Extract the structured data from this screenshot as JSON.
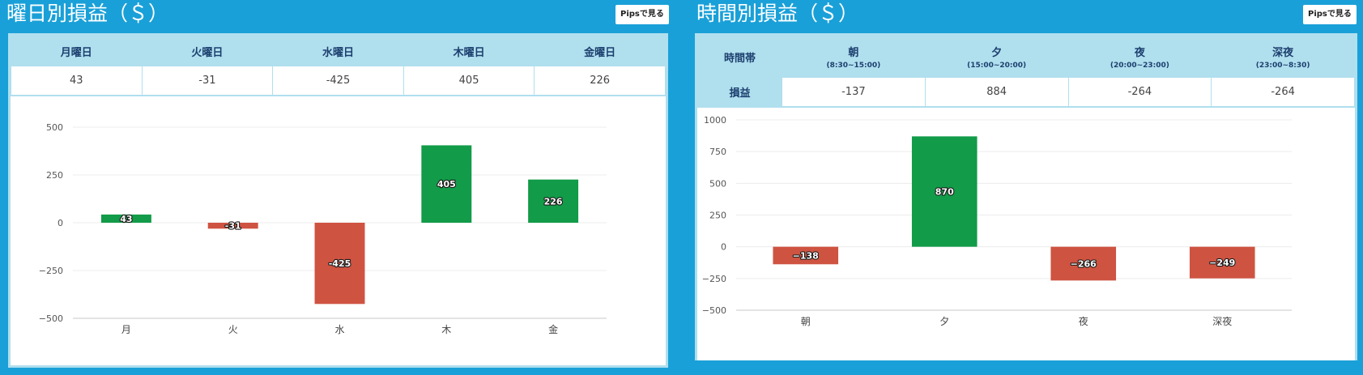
{
  "left": {
    "title": "曜日別損益（＄）",
    "pips_button": "Pipsで見る",
    "table": {
      "headers": [
        "月曜日",
        "火曜日",
        "水曜日",
        "木曜日",
        "金曜日"
      ],
      "values": [
        "43",
        "-31",
        "-425",
        "405",
        "226"
      ]
    }
  },
  "right": {
    "title": "時間別損益（＄）",
    "pips_button": "Pipsで見る",
    "table": {
      "corner": "時間帯",
      "row_label": "損益",
      "headers": [
        {
          "name": "朝",
          "range": "(8:30~15:00)"
        },
        {
          "name": "夕",
          "range": "(15:00~20:00)"
        },
        {
          "name": "夜",
          "range": "(20:00~23:00)"
        },
        {
          "name": "深夜",
          "range": "(23:00~8:30)"
        }
      ],
      "values": [
        "-137",
        "884",
        "-264",
        "-264"
      ]
    }
  },
  "colors": {
    "positive": "#129b48",
    "negative": "#cf5341",
    "frame": "#1aa0d8"
  },
  "chart_data": [
    {
      "type": "bar",
      "categories": [
        "月",
        "火",
        "水",
        "木",
        "金"
      ],
      "values": [
        43,
        -31,
        -425,
        405,
        226
      ],
      "labels": [
        "43",
        "-31",
        "-425",
        "405",
        "226"
      ],
      "ylim": [
        -500,
        500
      ],
      "yticks": [
        500,
        250,
        0,
        -250,
        -500
      ],
      "ytick_labels": [
        "500",
        "250",
        "0",
        "−250",
        "−500"
      ],
      "grid": true
    },
    {
      "type": "bar",
      "categories": [
        "朝",
        "夕",
        "夜",
        "深夜"
      ],
      "values": [
        -138,
        870,
        -266,
        -249
      ],
      "labels": [
        "−138",
        "870",
        "−266",
        "−249"
      ],
      "ylim": [
        -500,
        1000
      ],
      "yticks": [
        1000,
        750,
        500,
        250,
        0,
        -250,
        -500
      ],
      "ytick_labels": [
        "1000",
        "750",
        "500",
        "250",
        "0",
        "−250",
        "−500"
      ],
      "grid": true
    }
  ]
}
